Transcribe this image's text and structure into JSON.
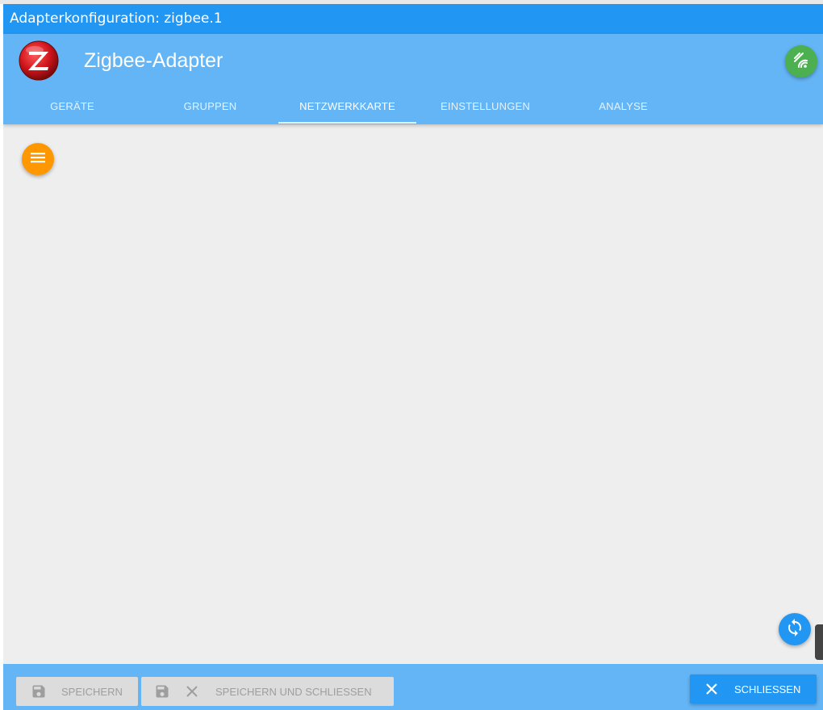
{
  "window": {
    "title": "Adapterkonfiguration: zigbee.1"
  },
  "header": {
    "logo_icon": "zigbee-logo-icon",
    "app_title": "Zigbee-Adapter",
    "status_icon": "wifi-status-icon",
    "status_color": "#4caf50"
  },
  "tabs": [
    {
      "label": "GERÄTE",
      "active": false
    },
    {
      "label": "GRUPPEN",
      "active": false
    },
    {
      "label": "NETZWERKKARTE",
      "active": true
    },
    {
      "label": "EINSTELLUNGEN",
      "active": false
    },
    {
      "label": "ANALYSE",
      "active": false
    }
  ],
  "main": {
    "menu_button_icon": "menu-icon",
    "menu_button_color": "#ff9800",
    "refresh_button_icon": "refresh-icon",
    "refresh_button_color": "#2196f3"
  },
  "footer": {
    "save_label": "SPEICHERN",
    "save_close_label": "SPEICHERN UND SCHLIESSEN",
    "close_label": "SCHLIESSEN"
  },
  "colors": {
    "title_bar": "#2196f3",
    "header": "#64b5f6",
    "background": "#eeeeee"
  }
}
